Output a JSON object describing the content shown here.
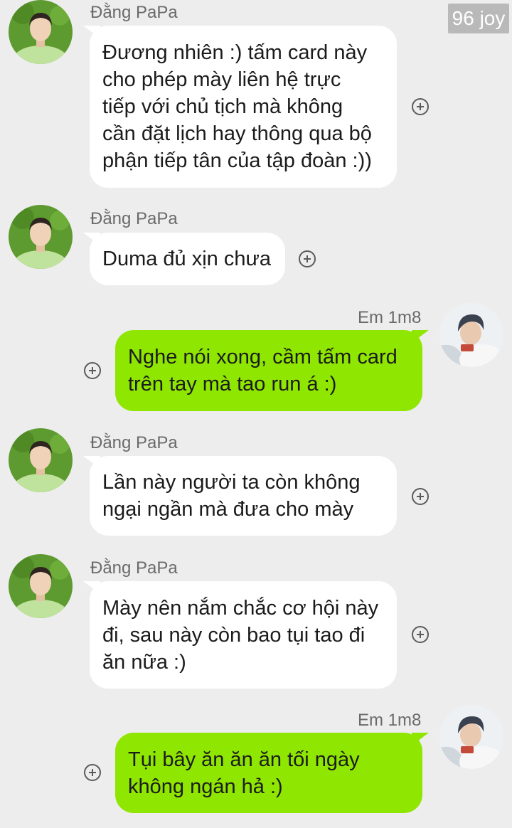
{
  "watermark": "96 joy",
  "colors": {
    "background": "#ededed",
    "incoming_bubble": "#ffffff",
    "outgoing_bubble": "#8fe600"
  },
  "messages": [
    {
      "sender": "Đằng PaPa",
      "direction": "incoming",
      "lines": [
        "Đương nhiên :) tấm card này",
        "cho phép mày liên hệ trực",
        "tiếp với chủ tịch mà không",
        "cần đặt lịch hay thông qua bộ",
        "phận tiếp tân của tập đoàn :))"
      ]
    },
    {
      "sender": "Đằng PaPa",
      "direction": "incoming",
      "lines": [
        "Duma đủ xịn chưa"
      ]
    },
    {
      "sender": "Em 1m8",
      "direction": "outgoing",
      "lines": [
        "Nghe nói xong, cầm tấm card",
        "trên tay mà tao run á :)"
      ]
    },
    {
      "sender": "Đằng PaPa",
      "direction": "incoming",
      "lines": [
        "Lần này người ta còn không",
        "ngại ngần mà đưa cho mày"
      ]
    },
    {
      "sender": "Đằng PaPa",
      "direction": "incoming",
      "lines": [
        "Mày nên nắm chắc cơ hội này",
        "đi, sau này còn bao tụi tao đi",
        "ăn nữa :)"
      ]
    },
    {
      "sender": "Em 1m8",
      "direction": "outgoing",
      "lines": [
        "Tụi bây ăn ăn ăn tối ngày",
        "không ngán hả :)"
      ]
    }
  ],
  "icons": {
    "add_reaction": "plus-circle-icon",
    "incoming_avatar": "avatar-dang-papa",
    "outgoing_avatar": "avatar-em-1m8"
  }
}
